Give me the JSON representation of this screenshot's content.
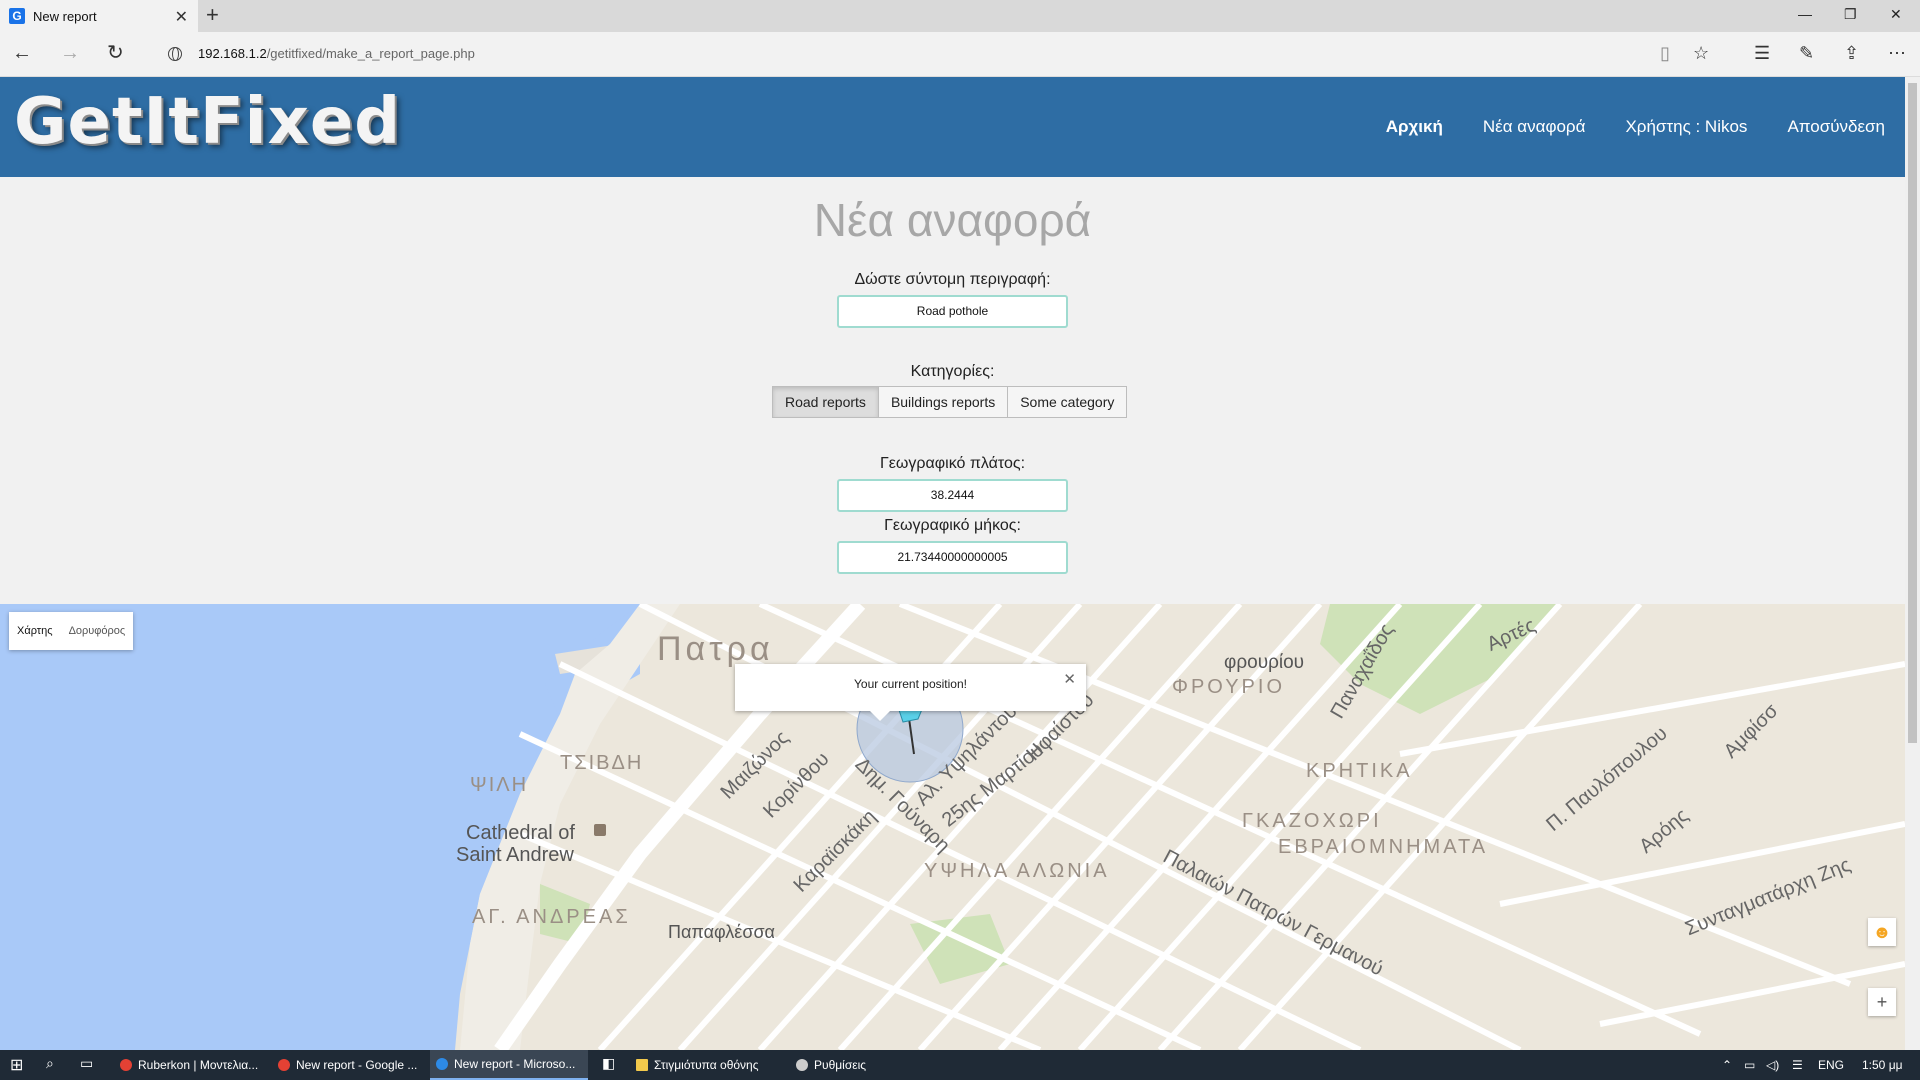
{
  "browser": {
    "tab_title": "New report",
    "tab_icon": "G",
    "url_host": "192.168.1.2",
    "url_path": "/getitfixed/make_a_report_page.php"
  },
  "site": {
    "logo": "GetItFixed",
    "nav": [
      {
        "label": "Αρχική",
        "active": true
      },
      {
        "label": "Νέα αναφορά",
        "active": false
      },
      {
        "label": "Χρήστης : Nikos",
        "active": false
      },
      {
        "label": "Αποσύνδεση",
        "active": false
      }
    ]
  },
  "form": {
    "title": "Νέα αναφορά",
    "description_label": "Δώστε σύντομη περιγραφή:",
    "description_value": "Road pothole",
    "categories_label": "Κατηγορίες:",
    "categories": [
      "Road reports",
      "Buildings reports",
      "Some category"
    ],
    "selected_category": "Road reports",
    "latitude_label": "Γεωγραφικό πλάτος:",
    "latitude_value": "38.2444",
    "longitude_label": "Γεωγραφικό μήκος:",
    "longitude_value": "21.73440000000005"
  },
  "map": {
    "type_map": "Χάρτης",
    "type_satellite": "Δορυφόρος",
    "info_text": "Your current position!",
    "labels": {
      "city": "Πατρα",
      "tsivdi": "ΤΣΙΒΔΗ",
      "psili": "ΨΙΛΗ",
      "cathedral_1": "Cathedral of",
      "cathedral_2": "Saint Andrew",
      "ag_andreas": "ΑΓ. ΑΝΔΡΕΑΣ",
      "papaflessa": "Παπαφλέσσα",
      "fourio_lower": "φρουρίου",
      "fourio": "ΦΡΟΥΡΙΟ",
      "kritika": "ΚΡΗΤΙΚΑ",
      "gkazochori": "ΓΚΑΖΟΧΩΡΙ",
      "evraiomnimata": "ΕΒΡΑΙΟΜΝΗΜΑΤΑ",
      "psila_alonia": "ΥΨΗΛΑ ΑΛΩΝΙΑ",
      "maizonos": "Μαιζώνος",
      "korinthou": "Κορίνθου",
      "dim_gounari": "Δημ. Γούναρη",
      "al_ypsilantou": "Αλ. Υψηλάντου",
      "martiou": "25ης Μαρτίου",
      "ifaistou": "Ηφαίστου",
      "karaiskaki": "Καραϊσκάκη",
      "panachaidos": "Παναχαΐδος",
      "artes": "Αρτές",
      "palaion_patron": "Παλαιών Πατρών Γερμανού",
      "p_pavlopoulou": "Π. Παυλόπουλου",
      "aroni": "Αρόης",
      "syntagmatarchi": "Συνταγματάρχη Ζης",
      "amfissis": "Αμφίσσ"
    }
  },
  "taskbar": {
    "items": [
      {
        "label": "Ruberkon | Μοντελια...",
        "color": "#e44134"
      },
      {
        "label": "New report - Google ...",
        "color": "#e44134"
      },
      {
        "label": "New report - Microso...",
        "color": "#2d8ae6"
      },
      {
        "label": "Στιγμιότυπα οθόνης",
        "color": "#f2c94c"
      },
      {
        "label": "Ρυθμίσεις",
        "color": "#cccccc"
      }
    ],
    "lang": "ENG",
    "time": "1:50 μμ"
  }
}
